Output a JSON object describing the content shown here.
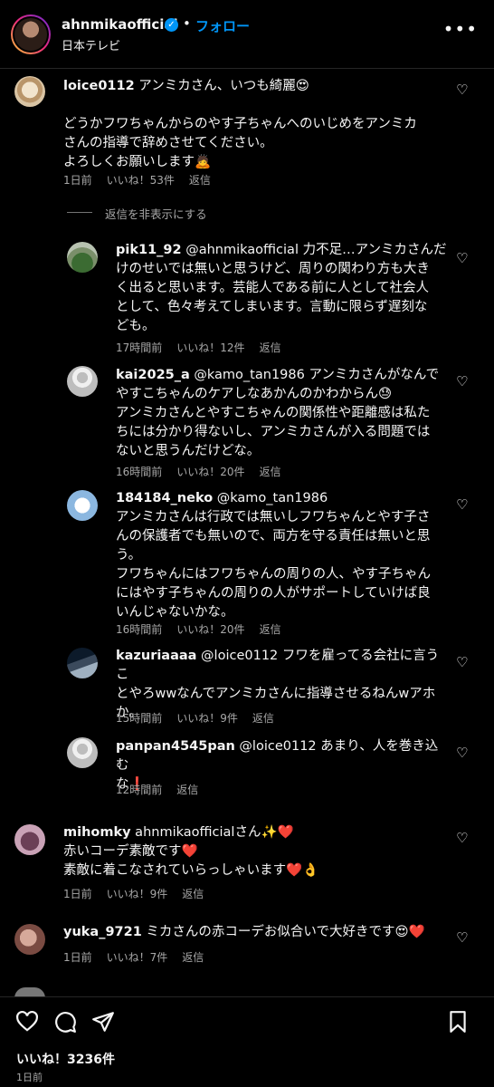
{
  "header": {
    "username": "ahnmikaofficial",
    "verified": "✓",
    "separator": "•",
    "follow_label": "フォロー",
    "subtitle": "日本テレビ",
    "more": "•••"
  },
  "comments": [
    {
      "user": "loice0112",
      "text_line1": " アンミカさん、いつも綺麗😍",
      "text_line2": "どうかフワちゃんからのやす子ちゃんへのいじめをアンミカ",
      "text_line3": "さんの指導で辞めさせてください。",
      "text_line4": "よろしくお願いします🙇",
      "time": "1日前",
      "likes": "いいね！53件",
      "reply": "返信"
    }
  ],
  "hide_replies": "返信を非表示にする",
  "replies": [
    {
      "user": "pik11_92",
      "line1": " @ahnmikaofficial 力不足…アンミカさんだ",
      "line2": "けのせいでは無いと思うけど、周りの関わり方も大き",
      "line3": "く出ると思います。芸能人である前に人として社会人",
      "line4": "として、色々考えてしまいます。言動に限らず遅刻な",
      "line5": "ども。",
      "time": "17時間前",
      "likes": "いいね！12件",
      "reply": "返信"
    },
    {
      "user": "kai2025_a",
      "line1": " @kamo_tan1986 アンミカさんがなんで",
      "line2": "やすこちゃんのケアしなあかんのかわからん😓",
      "line3": "アンミカさんとやすこちゃんの関係性や距離感は私た",
      "line4": "ちには分かり得ないし、アンミカさんが入る問題では",
      "line5": "ないと思うんだけどな。",
      "time": "16時間前",
      "likes": "いいね！20件",
      "reply": "返信"
    },
    {
      "user": "184184_neko",
      "line1": " @kamo_tan1986",
      "line2": "アンミカさんは行政では無いしフワちゃんとやす子さ",
      "line3": "んの保護者でも無いので、両方を守る責任は無いと思",
      "line4": "う。",
      "line5": "フワちゃんにはフワちゃんの周りの人、やす子ちゃん",
      "line6": "にはやす子ちゃんの周りの人がサポートしていけば良",
      "line7": "いんじゃないかな。",
      "time": "16時間前",
      "likes": "いいね！20件",
      "reply": "返信"
    },
    {
      "user": "kazuriaaaa",
      "line1": " @loice0112 フワを雇ってる会社に言うこ",
      "line2": "とやろwwなんでアンミカさんに指導させるねんwアホ",
      "line3": "か。",
      "time": "15時間前",
      "likes": "いいね！9件",
      "reply": "返信"
    },
    {
      "user": "panpan4545pan",
      "line1": " @loice0112 あまり、人を巻き込む",
      "line2": "な❗",
      "time": "12時間前",
      "reply": "返信"
    }
  ],
  "comments2": [
    {
      "user": "mihomky",
      "line1": " ahnmikaofficialさん✨❤️",
      "line2": "赤いコーデ素敵です❤️",
      "line3": "素敵に着こなされていらっしゃいます❤️👌",
      "time": "1日前",
      "likes": "いいね！9件",
      "reply": "返信"
    },
    {
      "user": "yuka_9721",
      "line1": " ミカさんの赤コーデお似合いで大好きです😍❤️",
      "time": "1日前",
      "likes": "いいね！7件",
      "reply": "返信"
    }
  ],
  "partial_comment": "…",
  "footer": {
    "likes": "いいね！3236件",
    "date": "1日前"
  },
  "icons": [
    "heart-icon",
    "comment-icon",
    "share-icon",
    "bookmark-icon"
  ]
}
